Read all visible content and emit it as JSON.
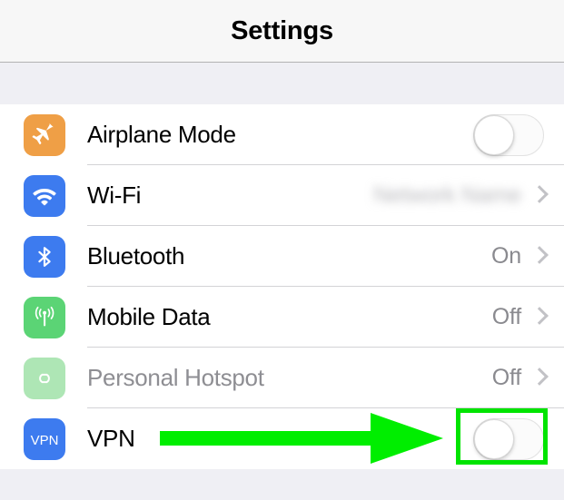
{
  "header": {
    "title": "Settings"
  },
  "settings_list": {
    "rows": [
      {
        "id": "airplane-mode",
        "label": "Airplane Mode",
        "icon": "airplane-icon",
        "icon_color": "#ef9f46",
        "control": "toggle",
        "toggle_state": "off",
        "disabled": false
      },
      {
        "id": "wifi",
        "label": "Wi-Fi",
        "icon": "wifi-icon",
        "icon_color": "#3d7bef",
        "control": "chevron",
        "value": "Network Name",
        "value_redacted": true,
        "disabled": false
      },
      {
        "id": "bluetooth",
        "label": "Bluetooth",
        "icon": "bluetooth-icon",
        "icon_color": "#3d7bef",
        "control": "chevron",
        "value": "On",
        "value_redacted": false,
        "disabled": false
      },
      {
        "id": "mobile-data",
        "label": "Mobile Data",
        "icon": "antenna-icon",
        "icon_color": "#5bd475",
        "control": "chevron",
        "value": "Off",
        "value_redacted": false,
        "disabled": false
      },
      {
        "id": "personal-hotspot",
        "label": "Personal Hotspot",
        "icon": "hotspot-link-icon",
        "icon_color": "#aee6b5",
        "control": "chevron",
        "value": "Off",
        "value_redacted": false,
        "disabled": true
      },
      {
        "id": "vpn",
        "label": "VPN",
        "icon": "vpn-icon",
        "icon_color": "#3d7bef",
        "icon_text": "VPN",
        "control": "toggle",
        "toggle_state": "off",
        "disabled": false
      }
    ]
  },
  "annotation": {
    "arrow_color": "#00ee00",
    "highlight_color": "#00e400",
    "arrow_target": "vpn-toggle",
    "highlight_target": "vpn-toggle"
  },
  "theme": {
    "background": "#ffffff",
    "group_background": "#efeff4",
    "nav_background": "#f7f7f7",
    "separator": "#d3d3d6",
    "value_text": "#8a8a8f",
    "disabled_text": "#8e8e93"
  }
}
